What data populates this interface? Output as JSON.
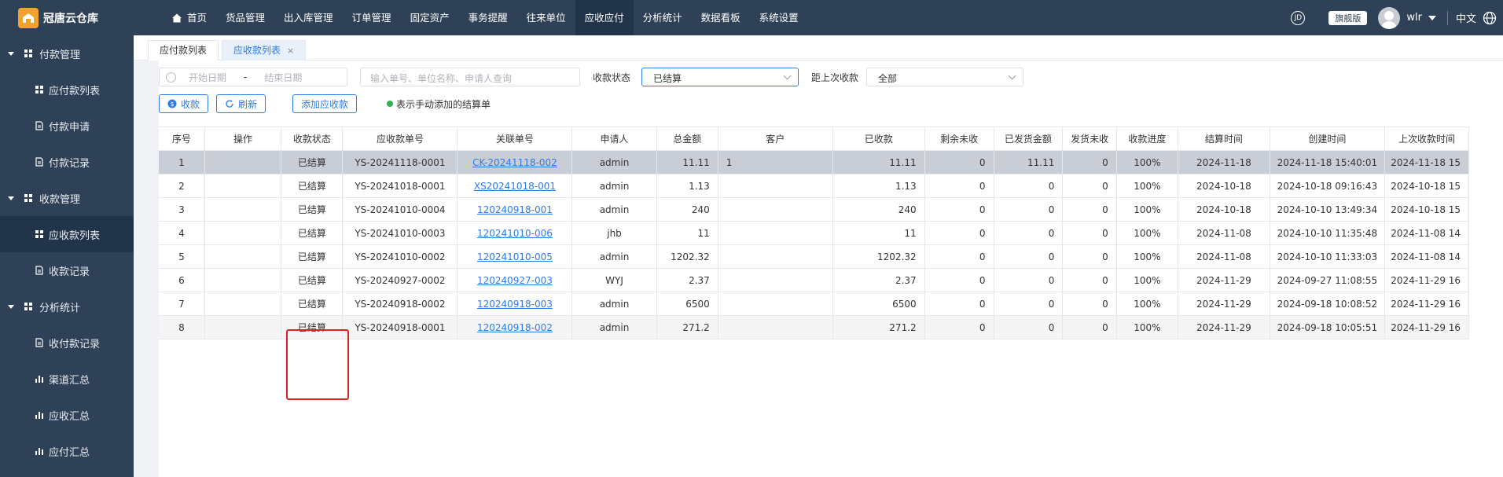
{
  "app": {
    "name": "冠唐云仓库"
  },
  "nav": [
    {
      "label": "首页",
      "active": false
    },
    {
      "label": "货品管理",
      "active": false
    },
    {
      "label": "出入库管理",
      "active": false
    },
    {
      "label": "订单管理",
      "active": false
    },
    {
      "label": "固定资产",
      "active": false
    },
    {
      "label": "事务提醒",
      "active": false
    },
    {
      "label": "往来单位",
      "active": false
    },
    {
      "label": "应收应付",
      "active": true
    },
    {
      "label": "分析统计",
      "active": false
    },
    {
      "label": "数据看板",
      "active": false
    },
    {
      "label": "系统设置",
      "active": false
    }
  ],
  "topright": {
    "badge": "旗舰版",
    "user": "wlr",
    "lang": "中文"
  },
  "sidebar": {
    "group1": "付款管理",
    "g1items": [
      "应付款列表",
      "付款申请",
      "付款记录"
    ],
    "group2": "收款管理",
    "g2items": [
      "应收款列表",
      "收款记录"
    ],
    "group3": "分析统计",
    "g3items": [
      "收付款记录",
      "渠道汇总",
      "应收汇总",
      "应付汇总"
    ]
  },
  "tabs": [
    {
      "label": "应付款列表"
    },
    {
      "label": "应收款列表",
      "close": "×"
    }
  ],
  "filters": {
    "start_placeholder": "开始日期",
    "sep": "-",
    "end_placeholder": "结束日期",
    "search_placeholder": "输入单号、单位名称、申请人查询",
    "status_label": "收款状态",
    "status_value": "已结算",
    "last_label": "距上次收款",
    "last_value": "全部"
  },
  "actions": {
    "collect": "收款",
    "refresh": "刷新",
    "add": "添加应收款",
    "legend": "表示手动添加的结算单"
  },
  "table": {
    "headers": [
      "序号",
      "操作",
      "收款状态",
      "应收款单号",
      "关联单号",
      "申请人",
      "总金额",
      "客户",
      "已收款",
      "剩余未收",
      "已发货金额",
      "发货未收",
      "收款进度",
      "结算时间",
      "创建时间",
      "上次收款时间"
    ],
    "rows": [
      [
        "1",
        "",
        "已结算",
        "YS-20241118-0001",
        "CK-20241118-002",
        "admin",
        "11.11",
        "1",
        "11.11",
        "0",
        "11.11",
        "0",
        "100%",
        "2024-11-18",
        "2024-11-18 15:40:01",
        "2024-11-18 15"
      ],
      [
        "2",
        "",
        "已结算",
        "YS-20241018-0001",
        "XS20241018-001",
        "admin",
        "1.13",
        "",
        "1.13",
        "0",
        "0",
        "0",
        "100%",
        "2024-10-18",
        "2024-10-18 09:16:43",
        "2024-10-18 15"
      ],
      [
        "3",
        "",
        "已结算",
        "YS-20241010-0004",
        "120240918-001",
        "admin",
        "240",
        "",
        "240",
        "0",
        "0",
        "0",
        "100%",
        "2024-10-18",
        "2024-10-10 13:49:34",
        "2024-10-18 15"
      ],
      [
        "4",
        "",
        "已结算",
        "YS-20241010-0003",
        "120241010-006",
        "jhb",
        "11",
        "",
        "11",
        "0",
        "0",
        "0",
        "100%",
        "2024-11-08",
        "2024-10-10 11:35:48",
        "2024-11-08 14"
      ],
      [
        "5",
        "",
        "已结算",
        "YS-20241010-0002",
        "120241010-005",
        "admin",
        "1202.32",
        "",
        "1202.32",
        "0",
        "0",
        "0",
        "100%",
        "2024-11-08",
        "2024-10-10 11:33:03",
        "2024-11-08 14"
      ],
      [
        "6",
        "",
        "已结算",
        "YS-20240927-0002",
        "120240927-003",
        "WYJ",
        "2.37",
        "",
        "2.37",
        "0",
        "0",
        "0",
        "100%",
        "2024-11-29",
        "2024-09-27 11:08:55",
        "2024-11-29 16"
      ],
      [
        "7",
        "",
        "已结算",
        "YS-20240918-0002",
        "120240918-003",
        "admin",
        "6500",
        "",
        "6500",
        "0",
        "0",
        "0",
        "100%",
        "2024-11-29",
        "2024-09-18 10:08:52",
        "2024-11-29 16"
      ],
      [
        "8",
        "",
        "已结算",
        "YS-20240918-0001",
        "120240918-002",
        "admin",
        "271.2",
        "",
        "271.2",
        "0",
        "0",
        "0",
        "100%",
        "2024-11-29",
        "2024-09-18 10:05:51",
        "2024-11-29 16"
      ]
    ]
  },
  "colors": {
    "nav_bg": "#2f4157",
    "accent": "#2d7be5",
    "highlight": "#e02020"
  }
}
